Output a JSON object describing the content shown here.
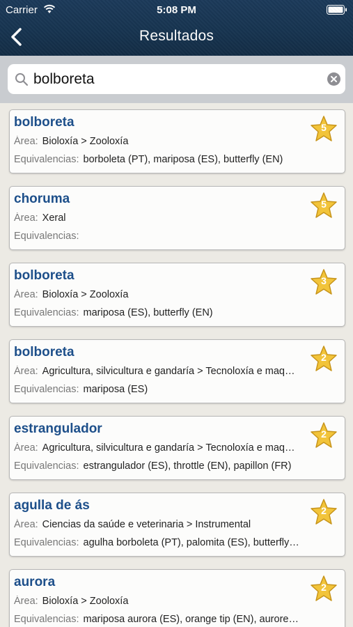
{
  "status_bar": {
    "carrier": "Carrier",
    "time": "5:08 PM"
  },
  "nav": {
    "title": "Resultados"
  },
  "search": {
    "value": "bolboreta"
  },
  "labels": {
    "area": "Área:",
    "equivalences": "Equivalencias:"
  },
  "colors": {
    "term": "#1d4f8a",
    "star_fill": "#f2c43a",
    "header_bg": "#173450"
  },
  "results": [
    {
      "term": "bolboreta",
      "area": "Bioloxía > Zooloxía",
      "equivalences": "borboleta (PT), mariposa (ES), butterfly (EN)",
      "rating": "5"
    },
    {
      "term": "choruma",
      "area": "Xeral",
      "equivalences": "",
      "rating": "5"
    },
    {
      "term": "bolboreta",
      "area": "Bioloxía > Zooloxía",
      "equivalences": "mariposa (ES), butterfly (EN)",
      "rating": "3"
    },
    {
      "term": "bolboreta",
      "area": "Agricultura, silvicultura e gandaría > Tecnoloxía e maq…",
      "equivalences": "mariposa (ES)",
      "rating": "2"
    },
    {
      "term": "estrangulador",
      "area": "Agricultura, silvicultura e gandaría > Tecnoloxía e maq…",
      "equivalences": "estrangulador (ES), throttle (EN), papillon (FR)",
      "rating": "2"
    },
    {
      "term": "agulla de ás",
      "area": "Ciencias da saúde e veterinaria > Instrumental",
      "equivalences": "agulha borboleta (PT), palomita (ES), butterfly…",
      "rating": "2"
    },
    {
      "term": "aurora",
      "area": "Bioloxía > Zooloxía",
      "equivalences": "mariposa aurora (ES), orange tip (EN), aurore…",
      "rating": "2"
    }
  ]
}
